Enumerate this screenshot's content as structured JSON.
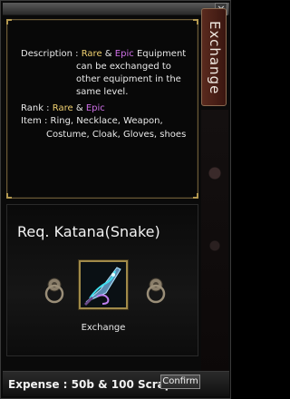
{
  "window": {
    "close_label": "×"
  },
  "side_tab": {
    "label": "Exchange"
  },
  "info": {
    "description_label": "Description :",
    "desc_line1_rare": "Rare",
    "desc_line1_amp": "&",
    "desc_line1_epic": "Epic",
    "desc_line1_rest": "Equipment",
    "desc_line2": "can be exchanged to",
    "desc_line3": "other equipment in the",
    "desc_line4": "same level.",
    "rank_label": "Rank :",
    "rank_rare": "Rare",
    "rank_amp": "&",
    "rank_epic": "Epic",
    "item_label": "Item :",
    "item_line1": "Ring, Necklace, Weapon,",
    "item_line2": "Costume, Cloak, Gloves, shoes"
  },
  "req": {
    "title": "Req. Katana(Snake)",
    "item_icon": "katana-snake-icon",
    "item_label": "Exchange"
  },
  "bottom": {
    "expense": "Expense : 50b & 100 Scrap",
    "confirm_label": "Confirm"
  },
  "colors": {
    "rare": "#f0d070",
    "epic": "#d070e8",
    "text": "#e8e8e8",
    "frame_gold": "#a08a4a"
  }
}
